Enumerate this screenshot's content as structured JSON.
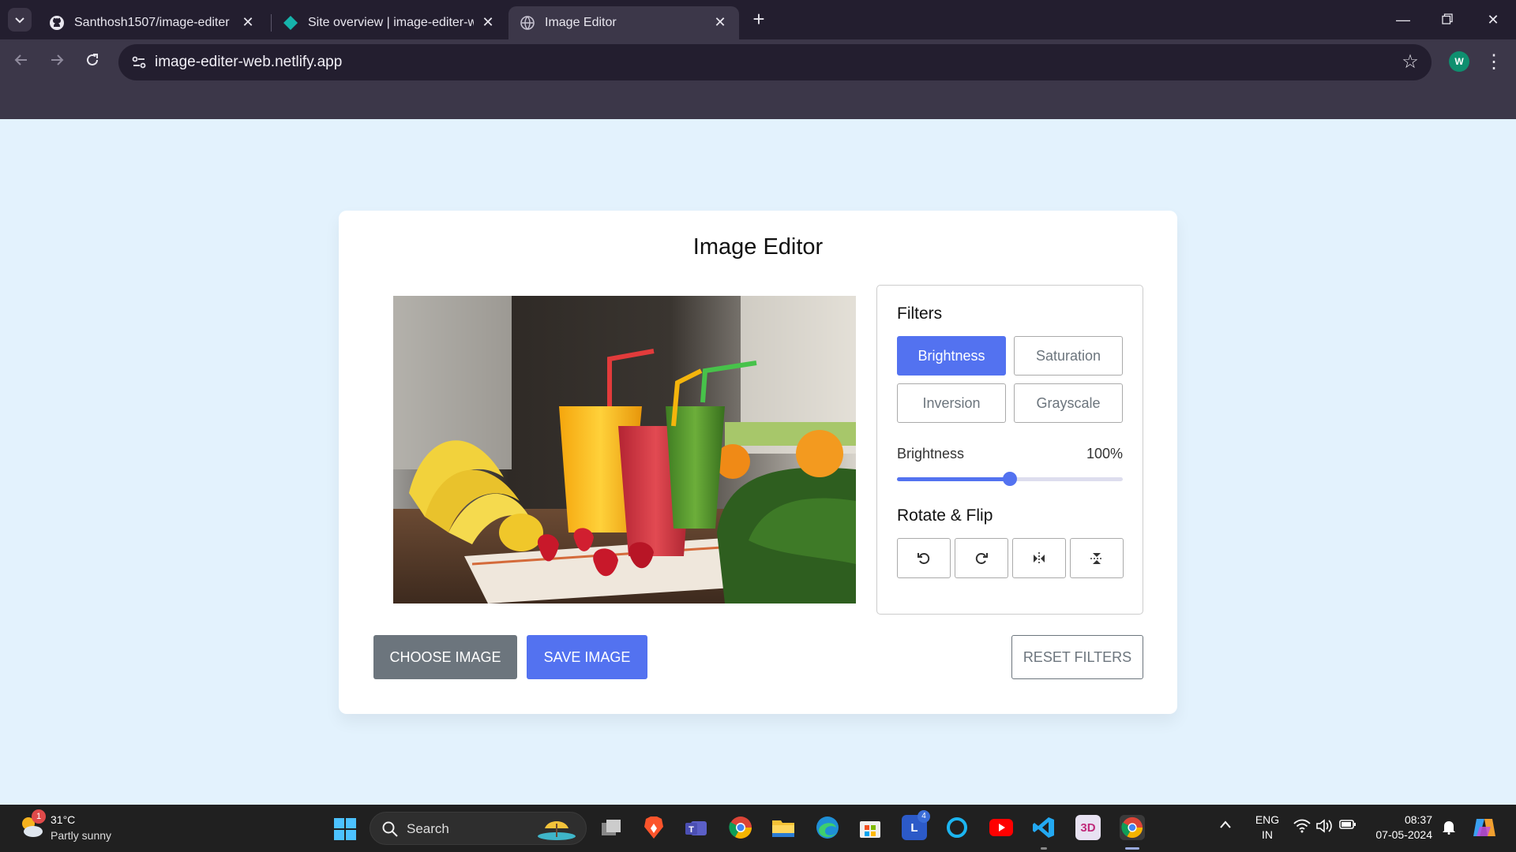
{
  "browser": {
    "tabs": [
      {
        "title": "Santhosh1507/image-editer",
        "active": false,
        "icon": "github-icon"
      },
      {
        "title": "Site overview | image-editer-web",
        "active": false,
        "icon": "netlify-icon"
      },
      {
        "title": "Image Editor",
        "active": true,
        "icon": "globe-icon"
      }
    ],
    "url": "image-editer-web.netlify.app",
    "profile_initial": "W"
  },
  "editor": {
    "title": "Image Editor",
    "filters_title": "Filters",
    "filters": [
      {
        "label": "Brightness",
        "active": true
      },
      {
        "label": "Saturation",
        "active": false
      },
      {
        "label": "Inversion",
        "active": false
      },
      {
        "label": "Grayscale",
        "active": false
      }
    ],
    "slider": {
      "name": "Brightness",
      "value_text": "100%",
      "value": 100,
      "max": 200
    },
    "rotate_title": "Rotate & Flip",
    "rotate_buttons": [
      "rotate-left-icon",
      "rotate-right-icon",
      "flip-horizontal-icon",
      "flip-vertical-icon"
    ],
    "choose_label": "CHOOSE IMAGE",
    "save_label": "SAVE IMAGE",
    "reset_label": "RESET FILTERS",
    "accent": "#5372f0"
  },
  "taskbar": {
    "weather_temp": "31°C",
    "weather_desc": "Partly sunny",
    "weather_badge": "1",
    "search_label": "Search",
    "lang_line1": "ENG",
    "lang_line2": "IN",
    "time": "08:37",
    "date": "07-05-2024",
    "apps": [
      {
        "name": "task-view-icon"
      },
      {
        "name": "brave-icon"
      },
      {
        "name": "teams-icon"
      },
      {
        "name": "chrome-icon"
      },
      {
        "name": "file-explorer-icon"
      },
      {
        "name": "edge-icon"
      },
      {
        "name": "store-icon"
      },
      {
        "name": "l-app-icon",
        "badge": "4"
      },
      {
        "name": "cortana-icon"
      },
      {
        "name": "youtube-icon"
      },
      {
        "name": "vscode-icon"
      },
      {
        "name": "3d-app-icon"
      },
      {
        "name": "chrome-profile-icon"
      }
    ]
  }
}
